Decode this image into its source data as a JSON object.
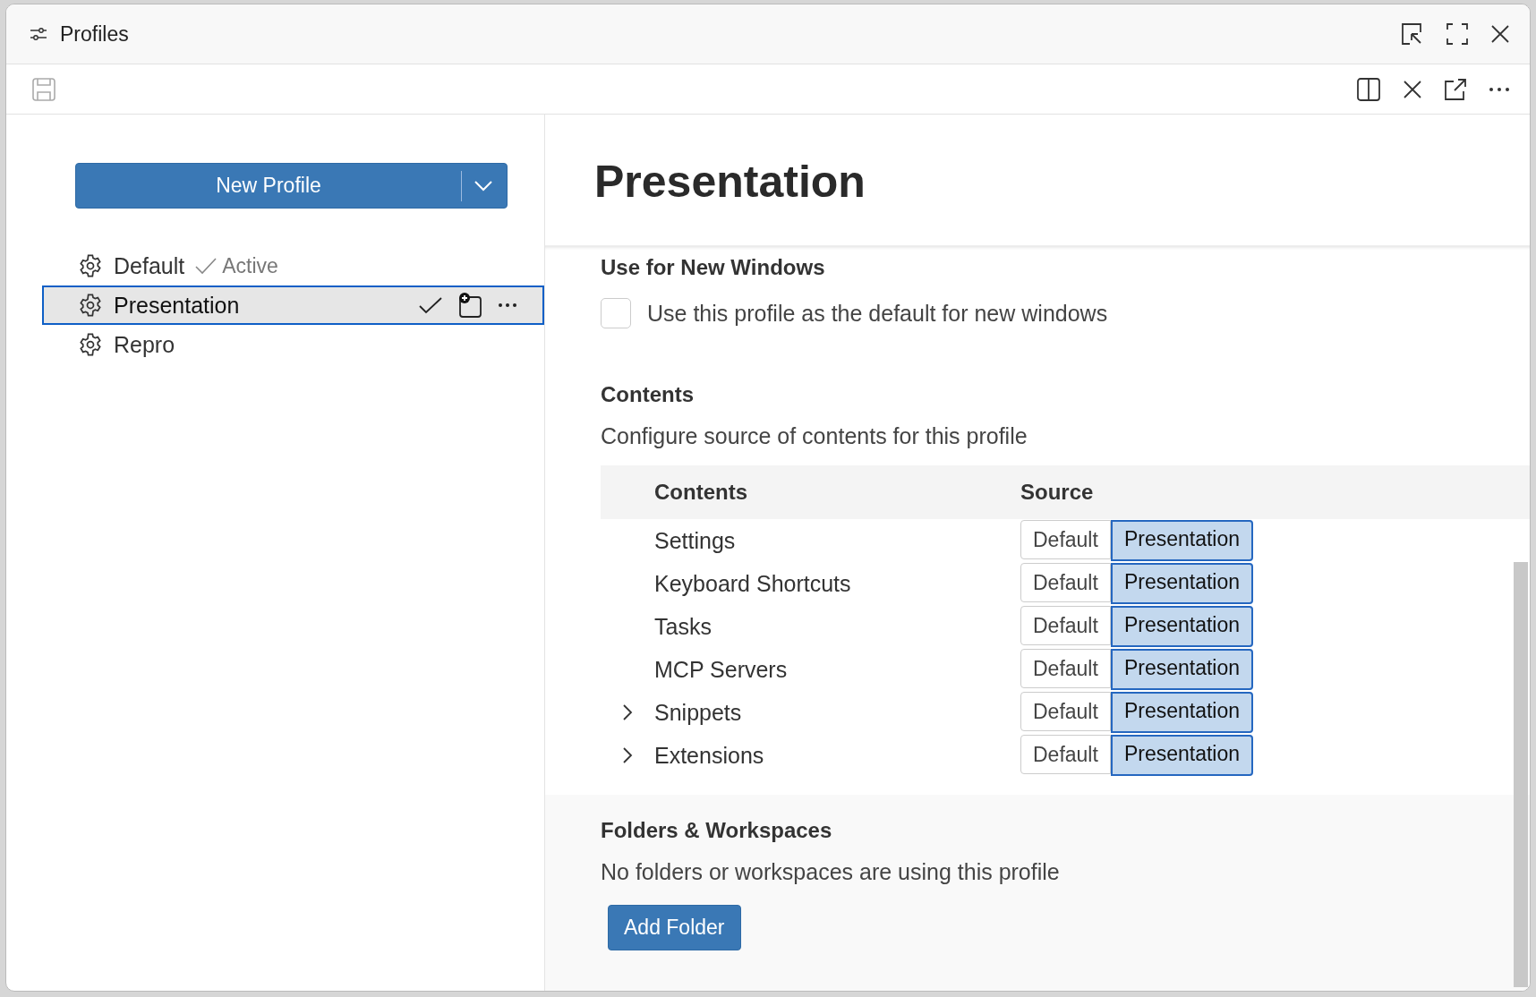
{
  "window": {
    "title": "Profiles"
  },
  "new_profile_button": {
    "label": "New Profile"
  },
  "profiles": [
    {
      "name": "Default",
      "active_label": "Active",
      "selected": false
    },
    {
      "name": "Presentation",
      "selected": true
    },
    {
      "name": "Repro",
      "selected": false
    }
  ],
  "detail": {
    "title": "Presentation",
    "new_windows": {
      "heading": "Use for New Windows",
      "label": "Use this profile as the default for new windows",
      "checked": false
    },
    "contents": {
      "heading": "Contents",
      "description": "Configure source of contents for this profile",
      "columns": [
        "Contents",
        "Source"
      ],
      "rows": [
        {
          "name": "Settings",
          "expandable": false,
          "options": [
            {
              "label": "Default",
              "selected": false
            },
            {
              "label": "Presentation",
              "selected": true
            }
          ]
        },
        {
          "name": "Keyboard Shortcuts",
          "expandable": false,
          "options": [
            {
              "label": "Default",
              "selected": false
            },
            {
              "label": "Presentation",
              "selected": true
            }
          ]
        },
        {
          "name": "Tasks",
          "expandable": false,
          "options": [
            {
              "label": "Default",
              "selected": false
            },
            {
              "label": "Presentation",
              "selected": true
            }
          ]
        },
        {
          "name": "MCP Servers",
          "expandable": false,
          "options": [
            {
              "label": "Default",
              "selected": false
            },
            {
              "label": "Presentation",
              "selected": true
            }
          ]
        },
        {
          "name": "Snippets",
          "expandable": true,
          "options": [
            {
              "label": "Default",
              "selected": false
            },
            {
              "label": "Presentation",
              "selected": true
            }
          ]
        },
        {
          "name": "Extensions",
          "expandable": true,
          "options": [
            {
              "label": "Default",
              "selected": false
            },
            {
              "label": "Presentation",
              "selected": true
            }
          ]
        }
      ]
    },
    "folders": {
      "heading": "Folders & Workspaces",
      "description": "No folders or workspaces are using this profile",
      "button": "Add Folder"
    }
  }
}
